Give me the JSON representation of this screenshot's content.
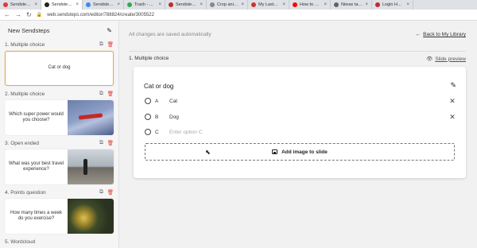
{
  "browser": {
    "tabs": [
      {
        "label": "Sendsteps - Inter",
        "favicon_color": "#e53935",
        "active": false
      },
      {
        "label": "Sendsteps Web",
        "favicon_color": "#222222",
        "active": true
      },
      {
        "label": "Sendsteps Web",
        "favicon_color": "#4285f4",
        "active": false
      },
      {
        "label": "Trash - Awesome",
        "favicon_color": "#34a853",
        "active": false
      },
      {
        "label": "Sendsteps Web",
        "favicon_color": "#c62828",
        "active": false
      },
      {
        "label": "Crop animated",
        "favicon_color": "#888888",
        "active": false
      },
      {
        "label": "My LastPass Va",
        "favicon_color": "#d32f2f",
        "active": false
      },
      {
        "label": "How to Screen",
        "favicon_color": "#ff0000",
        "active": false
      },
      {
        "label": "Nieuw tabblad",
        "favicon_color": "#5f6368",
        "active": false
      },
      {
        "label": "Login Hogeschool",
        "favicon_color": "#c62828",
        "active": false
      }
    ],
    "url": "web.sendsteps.com/editor/788824/create/3005522"
  },
  "sidebar": {
    "title": "New Sendsteps",
    "slides": [
      {
        "heading": "1. Multiple choice",
        "text": "Cat or dog",
        "image": "",
        "selected": true
      },
      {
        "heading": "2. Multiple choice",
        "text": "Which super power would you choose?",
        "image": "plane",
        "selected": false
      },
      {
        "heading": "3. Open ended",
        "text": "What was your best travel experience?",
        "image": "walk",
        "selected": false
      },
      {
        "heading": "4. Points question",
        "text": "How many times a week do you exercise?",
        "image": "rope",
        "selected": false
      },
      {
        "heading": "5. Wordcloud",
        "text": "",
        "image": "",
        "selected": false
      }
    ]
  },
  "main": {
    "saved_status": "All changes are saved automatically",
    "back_link": "Back to My Library",
    "section_title": "1. Multiple choice",
    "slide_preview": "Slide preview",
    "question": "Cat or dog",
    "options": [
      {
        "letter": "A",
        "text": "Cat",
        "placeholder": "",
        "removable": true
      },
      {
        "letter": "B",
        "text": "Dog",
        "placeholder": "",
        "removable": true
      },
      {
        "letter": "C",
        "text": "",
        "placeholder": "Enter option C",
        "removable": false
      }
    ],
    "add_image_label": "Add image to slide"
  }
}
